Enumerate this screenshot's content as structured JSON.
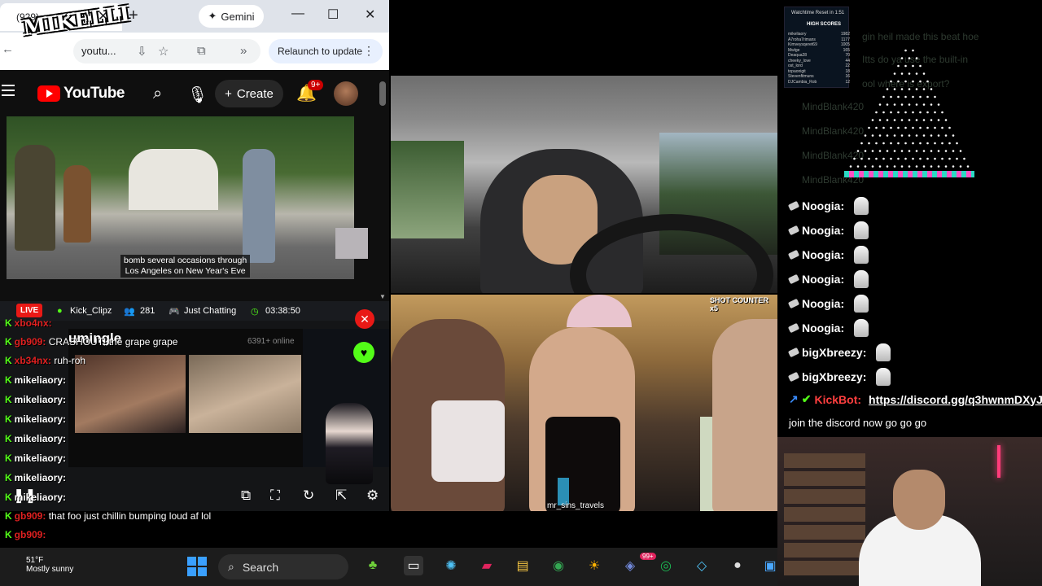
{
  "browser": {
    "tab_title": "(929)",
    "gemini_label": "Gemini",
    "url": "youtu...",
    "relaunch_label": "Relaunch to update",
    "overlay_logo": "MIKELLI"
  },
  "youtube": {
    "logo_text": "YouTube",
    "create_label": "Create",
    "notification_count": "9+",
    "caption_line1": "bomb several occasions through",
    "caption_line2": "Los Angeles on New Year's Eve"
  },
  "kick": {
    "live_label": "LIVE",
    "channel": "Kick_Clipz",
    "viewers": "281",
    "category": "Just Chatting",
    "uptime": "03:38:50",
    "omegle_title": "umingle",
    "online_count": "6391+ online"
  },
  "left_chat": [
    {
      "user": "xbo4nx:",
      "msg": "",
      "red": true
    },
    {
      "user": "gb909:",
      "msg": "CRASHOUT! the grape grape",
      "red": true
    },
    {
      "user": "xb34nx:",
      "msg": "ruh-roh",
      "red": true
    },
    {
      "user": "mikeliaory:",
      "msg": "",
      "red": false
    },
    {
      "user": "mikeliaory:",
      "msg": "",
      "red": false
    },
    {
      "user": "mikeliaory:",
      "msg": "",
      "red": false
    },
    {
      "user": "mikeliaory:",
      "msg": "",
      "red": false
    },
    {
      "user": "mikeliaory:",
      "msg": "",
      "red": false
    },
    {
      "user": "mikeliaory:",
      "msg": "",
      "red": false
    },
    {
      "user": "mikeliaory:",
      "msg": "",
      "red": false
    },
    {
      "user": "gb909:",
      "msg": "that foo just chillin bumping loud af lol",
      "red": true
    },
    {
      "user": "gb909:",
      "msg": "",
      "red": true
    },
    {
      "user": "xb34nx:",
      "msg": "",
      "red": true
    },
    {
      "user": "gb909:",
      "msg": "",
      "red": true
    }
  ],
  "girls_stream": {
    "shot_counter": "SHOT COUNTER x5",
    "watermark": "mr_sins_travels"
  },
  "right_chat": [
    {
      "user": "Noogia:"
    },
    {
      "user": "Noogia:"
    },
    {
      "user": "Noogia:"
    },
    {
      "user": "Noogia:"
    },
    {
      "user": "Noogia:"
    },
    {
      "user": "Noogia:"
    },
    {
      "user": "bigXbreezy:"
    },
    {
      "user": "bigXbreezy:"
    }
  ],
  "kickbot": {
    "user": "KickBot:",
    "link": "https://discord.gg/q3hwnmDXyJ",
    "message": "join the discord now go go go"
  },
  "faded_chat": [
    "gin heil made this beat hoe",
    "Itts do ya use the built-in",
    "ool where is export?",
    "MindBlank420",
    "MindBlank420",
    "MindBlank420",
    "MindBlank420"
  ],
  "stats": {
    "title": "Watchtime Reset in 1:51",
    "heading": "HIGH SCORES",
    "rows": [
      [
        "mikeliaory",
        "1982"
      ],
      [
        "A7roha7rimans",
        "1177"
      ],
      [
        "Kimveysqeret69",
        "1005"
      ],
      [
        "Mwlge",
        "165"
      ],
      [
        "Deaqua28",
        "70"
      ],
      [
        "cheeky_love",
        "44"
      ],
      [
        "ost_lord",
        "22"
      ],
      [
        "topaonigit",
        "18"
      ],
      [
        "Stevenfitmuns",
        "16"
      ],
      [
        "DJCambia_Rob",
        "12"
      ]
    ]
  },
  "taskbar": {
    "weather": "51°F",
    "weather_sub": "Mostly sunny",
    "search_placeholder": "Search",
    "discord_badge": "99+"
  }
}
